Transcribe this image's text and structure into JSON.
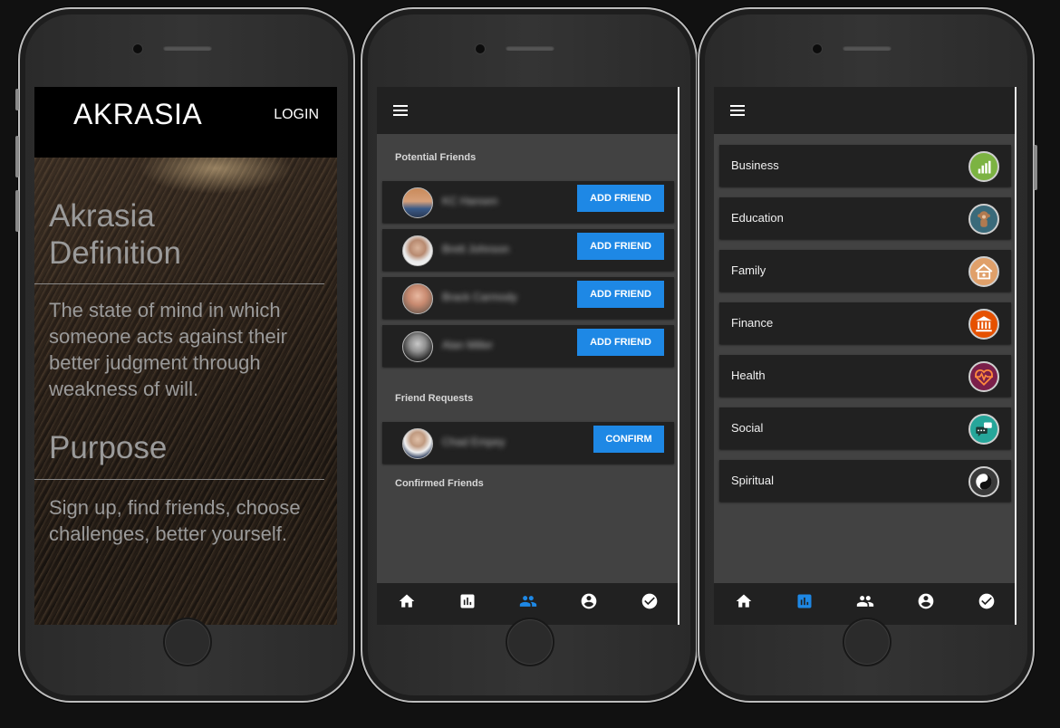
{
  "screen1": {
    "brand": "AKRASIA",
    "login": "LOGIN",
    "definition_title": "Akrasia Definition",
    "definition_text": "The state of mind in which someone acts against their better judgment through weakness of will.",
    "purpose_title": "Purpose",
    "purpose_text": "Sign up, find friends, choose challenges, better yourself."
  },
  "screen2": {
    "potential_title": "Potential Friends",
    "potential": [
      {
        "name": "KC Hansen",
        "button": "ADD FRIEND",
        "icon": "avatar-photo"
      },
      {
        "name": "Brett Johnson",
        "button": "ADD FRIEND",
        "icon": "avatar-photo"
      },
      {
        "name": "Brack Carmody",
        "button": "ADD FRIEND",
        "icon": "avatar-photo"
      },
      {
        "name": "Alan Miller",
        "button": "ADD FRIEND",
        "icon": "avatar-photo"
      }
    ],
    "requests_title": "Friend Requests",
    "requests": [
      {
        "name": "Chad Empey",
        "button": "CONFIRM",
        "icon": "avatar-photo"
      }
    ],
    "confirmed_title": "Confirmed Friends",
    "active_nav": "friends"
  },
  "screen3": {
    "categories": [
      {
        "label": "Business",
        "icon": "bar-chart-icon",
        "color": "#7cb342"
      },
      {
        "label": "Education",
        "icon": "monkey-icon",
        "color": "#3a6a7a"
      },
      {
        "label": "Family",
        "icon": "house-icon",
        "color": "#e0a06a"
      },
      {
        "label": "Finance",
        "icon": "bank-icon",
        "color": "#e65100"
      },
      {
        "label": "Health",
        "icon": "heartbeat-icon",
        "color": "#7b1f4a"
      },
      {
        "label": "Social",
        "icon": "chat-icon",
        "color": "#26a69a"
      },
      {
        "label": "Spiritual",
        "icon": "yin-yang-icon",
        "color": "#3a3a3a"
      }
    ],
    "active_nav": "stats"
  },
  "colors": {
    "accent": "#1e88e5",
    "appbar": "#212121",
    "content": "#424242"
  },
  "nav_items": [
    "home-icon",
    "stats-icon",
    "friends-icon",
    "account-icon",
    "check-icon"
  ]
}
